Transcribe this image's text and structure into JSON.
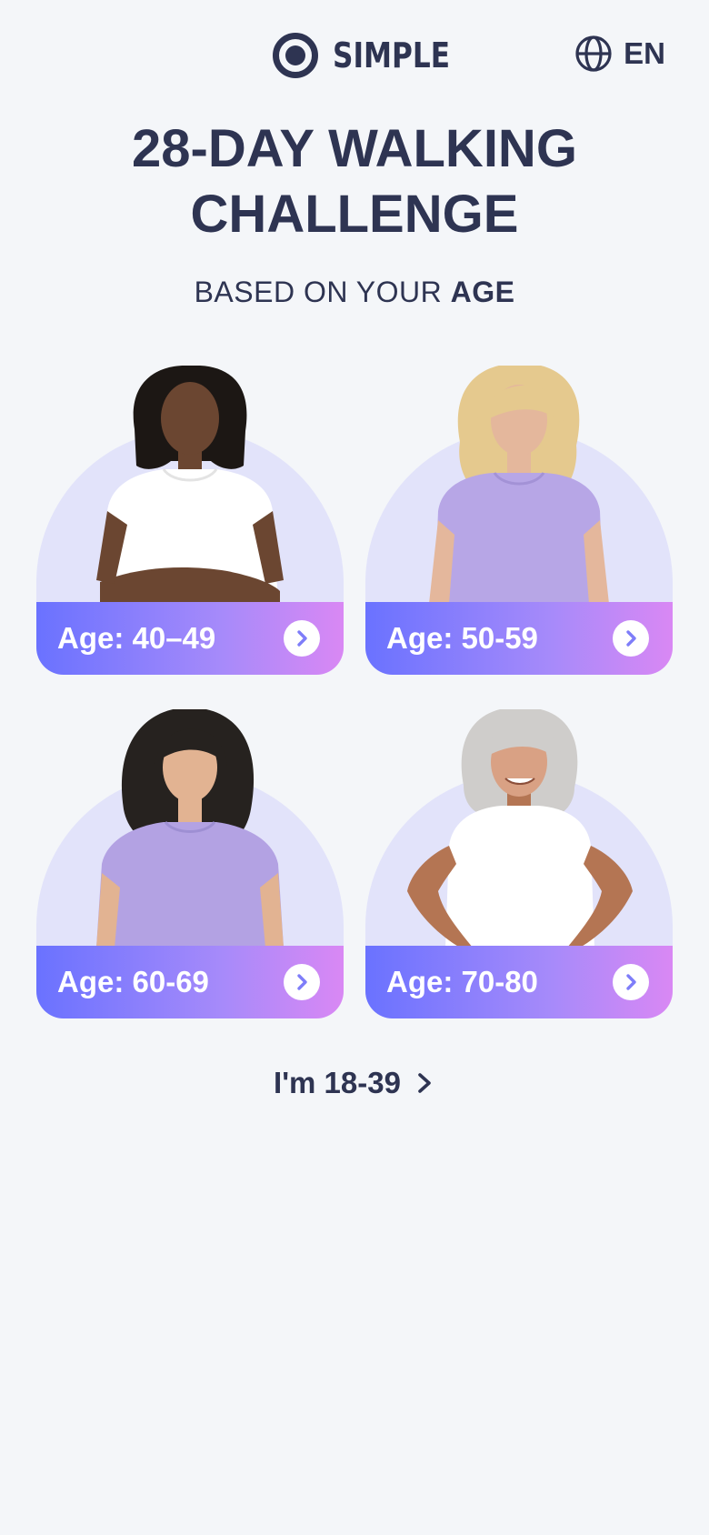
{
  "header": {
    "logo_text": "SIMPLE",
    "logo_icon": "circle-logo-icon",
    "language_icon": "globe-icon",
    "language_label": "EN"
  },
  "hero": {
    "title_line1": "28-DAY WALKING",
    "title_line2": "CHALLENGE",
    "subtitle_prefix": "BASED ON YOUR ",
    "subtitle_emphasis": "AGE"
  },
  "age_cards": [
    {
      "label": "Age: 40–49",
      "arrow_icon": "chevron-right-icon",
      "shirt_color": "#ffffff",
      "skin_color": "#6b4631",
      "hair_color": "#1c1714"
    },
    {
      "label": "Age: 50-59",
      "arrow_icon": "chevron-right-icon",
      "shirt_color": "#b7a6e6",
      "skin_color": "#e4b79c",
      "hair_color": "#e5c98e"
    },
    {
      "label": "Age: 60-69",
      "arrow_icon": "chevron-right-icon",
      "shirt_color": "#b3a2e3",
      "skin_color": "#e2b392",
      "hair_color": "#26221f"
    },
    {
      "label": "Age: 70-80",
      "arrow_icon": "chevron-right-icon",
      "shirt_color": "#ffffff",
      "skin_color": "#b47553",
      "hair_color": "#cfcdcb"
    }
  ],
  "footer_link": {
    "label": "I'm 18-39",
    "icon": "chevron-right-icon"
  },
  "colors": {
    "background": "#f4f6f9",
    "text_primary": "#2e3452",
    "card_arch": "#e2e3fa",
    "gradient_start": "#6a72ff",
    "gradient_end": "#d988f4"
  }
}
